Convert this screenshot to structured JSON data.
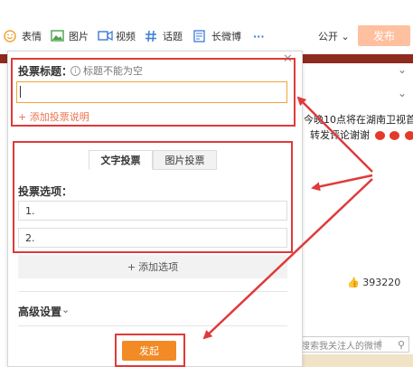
{
  "toolbar": {
    "items": [
      {
        "label": "表情",
        "icon": "smile-icon"
      },
      {
        "label": "图片",
        "icon": "image-icon"
      },
      {
        "label": "视频",
        "icon": "video-icon"
      },
      {
        "label": "话题",
        "icon": "hashtag-icon"
      },
      {
        "label": "长微博",
        "icon": "long-post-icon"
      },
      {
        "label": "···",
        "icon": "more-icon"
      }
    ],
    "visibility": "公开",
    "publish_label": "发布"
  },
  "feed": {
    "text_line1": "今晚10点将在湖南卫视首",
    "text_line2": "转发评论谢谢",
    "likes": "393220"
  },
  "poll": {
    "title_label": "投票标题：",
    "title_hint": "标题不能为空",
    "add_description": "添加投票说明",
    "tabs": [
      {
        "label": "文字投票",
        "active": true
      },
      {
        "label": "图片投票",
        "active": false
      }
    ],
    "options_label": "投票选项：",
    "options": [
      "1.",
      "2."
    ],
    "add_option": "添加选项",
    "advanced_label": "高级设置",
    "launch_label": "发起"
  },
  "search": {
    "placeholder": "搜索我关注人的微博"
  },
  "colors": {
    "annotation_red": "#e03a3a",
    "accent_orange": "#eb7350",
    "publish_disabled": "#ffc09f",
    "launch": "#f28a25",
    "input_focus": "#f2a33a"
  }
}
